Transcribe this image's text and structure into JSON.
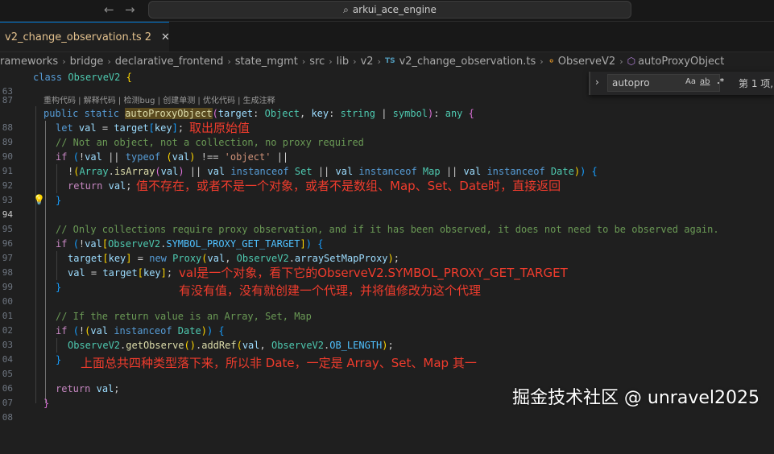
{
  "window": {
    "search_text": "arkui_ace_engine"
  },
  "tab": {
    "filename": "v2_change_observation.ts",
    "badge": "2"
  },
  "breadcrumb": [
    "rameworks",
    "bridge",
    "declarative_frontend",
    "state_mgmt",
    "src",
    "lib",
    "v2",
    "v2_change_observation.ts",
    "ObserveV2",
    "autoProxyObject"
  ],
  "codelens": "重构代码 | 解释代码 | 检测bug | 创建单测 | 优化代码 | 生成注释",
  "find": {
    "query": "autopro",
    "result": "第 1 项,",
    "opt_case": "Aa",
    "opt_word": "ab",
    "opt_regex": ".*"
  },
  "line_numbers": [
    "63",
    "87",
    "88",
    "89",
    "90",
    "91",
    "92",
    "93",
    "94",
    "95",
    "96",
    "97",
    "98",
    "99",
    "00",
    "01",
    "02",
    "03",
    "04",
    "05",
    "06",
    "07",
    "08"
  ],
  "code": {
    "l63": [
      "class",
      "ObserveV2",
      "{"
    ],
    "l88": [
      "public",
      "static",
      "autoProxyObject",
      "(",
      "target",
      ":",
      "Object",
      ",",
      "key",
      ":",
      "string",
      "|",
      "symbol",
      ")",
      ":",
      "any",
      "{"
    ],
    "l89": [
      "let",
      "val",
      "=",
      "target",
      "[",
      "key",
      "]",
      ";"
    ],
    "l90": "// Not an object, not a collection, no proxy required",
    "l91": [
      "if",
      "(",
      "!",
      "val",
      "||",
      "typeof",
      "(",
      "val",
      ")",
      "!==",
      "'object'",
      "||"
    ],
    "l92": [
      "!",
      "(",
      "Array",
      ".",
      "isArray",
      "(",
      "val",
      ")",
      "||",
      "val",
      "instanceof",
      "Set",
      "||",
      "val",
      "instanceof",
      "Map",
      "||",
      "val",
      "instanceof",
      "Date",
      ")",
      ")",
      "{"
    ],
    "l93": [
      "return",
      "val",
      ";"
    ],
    "l94": "}",
    "l96": "// Only collections require proxy observation, and if it has been observed, it does not need to be observed again.",
    "l97": [
      "if",
      "(",
      "!",
      "val",
      "[",
      "ObserveV2",
      ".",
      "SYMBOL_PROXY_GET_TARGET",
      "]",
      ")",
      "{"
    ],
    "l98": [
      "target",
      "[",
      "key",
      "]",
      "=",
      "new",
      "Proxy",
      "(",
      "val",
      ",",
      "ObserveV2",
      ".",
      "arraySetMapProxy",
      ")",
      ";"
    ],
    "l99": [
      "val",
      "=",
      "target",
      "[",
      "key",
      "]",
      ";"
    ],
    "l00": "}",
    "l02": "// If the return value is an Array, Set, Map",
    "l03": [
      "if",
      "(",
      "!",
      "(",
      "val",
      "instanceof",
      "Date",
      ")",
      ")",
      "{"
    ],
    "l04": [
      "ObserveV2",
      ".",
      "getObserve",
      "(",
      ")",
      ".",
      "addRef",
      "(",
      "val",
      ",",
      "ObserveV2",
      ".",
      "OB_LENGTH",
      ")",
      ";"
    ],
    "l05": "}",
    "l07": [
      "return",
      "val",
      ";"
    ],
    "l08": "}"
  },
  "annotations": {
    "a1": "取出原始值",
    "a2": "值不存在，或者不是一个对象，或者不是数组、Map、Set、Date时，直接返回",
    "a3": "val是一个对象，看下它的ObserveV2.SYMBOL_PROXY_GET_TARGET",
    "a4": "有没有值，没有就创建一个代理，并将值修改为这个代理",
    "a5": "上面总共四种类型落下来，所以非 Date，一定是 Array、Set、Map 其一"
  },
  "watermark": "掘金技术社区 @ unravel2025",
  "colors": {
    "annotation": "#f03c2d",
    "editor_bg": "#1f1f1f",
    "keyword": "#569cd6",
    "comment": "#6a9955"
  }
}
